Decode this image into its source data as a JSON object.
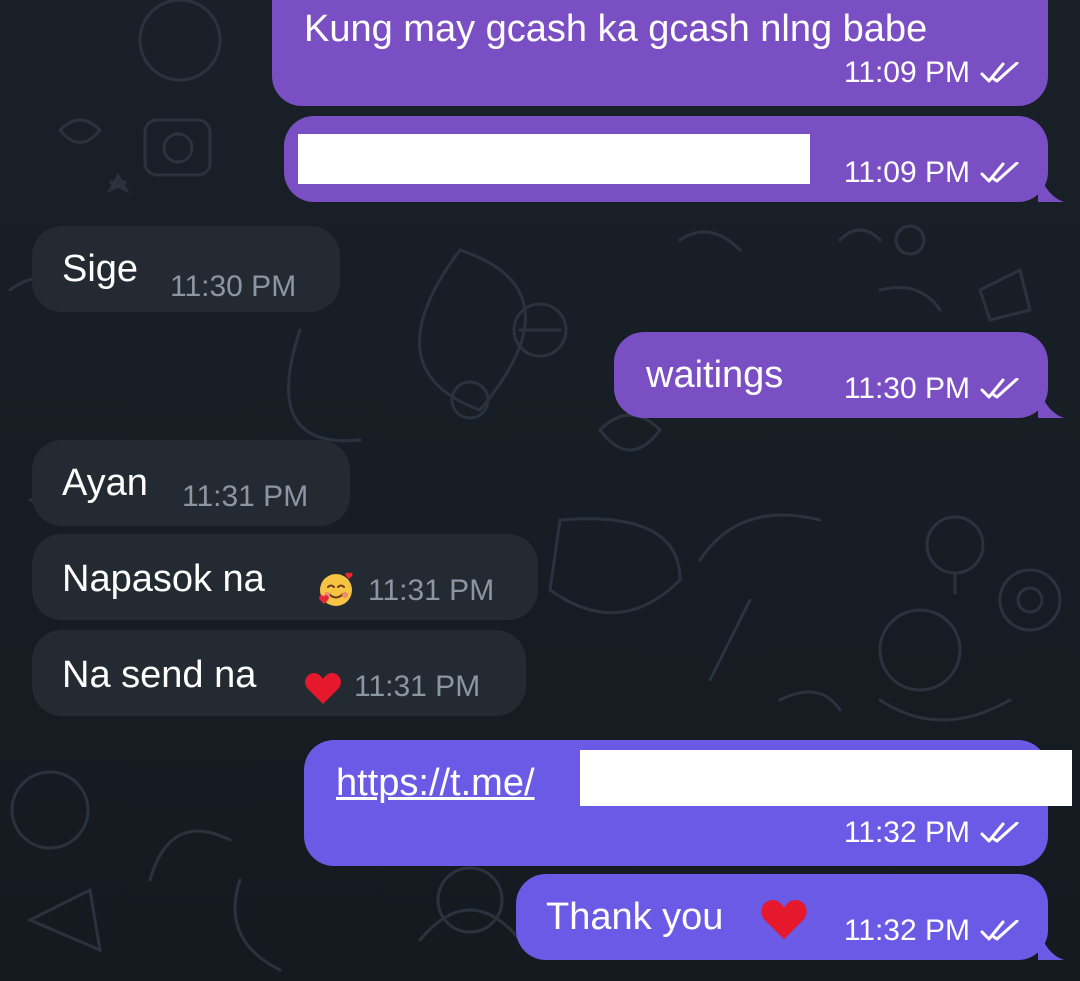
{
  "messages": [
    {
      "id": "m1",
      "direction": "outgoing",
      "text": "Kung may gcash ka gcash nlng babe",
      "time": "11:09 PM",
      "status": "read"
    },
    {
      "id": "m2",
      "direction": "outgoing",
      "text": "",
      "time": "11:09 PM",
      "status": "read",
      "redacted": true
    },
    {
      "id": "m3",
      "direction": "incoming",
      "text": "Sige",
      "time": "11:30 PM"
    },
    {
      "id": "m4",
      "direction": "outgoing",
      "text": "waitings",
      "time": "11:30 PM",
      "status": "read"
    },
    {
      "id": "m5",
      "direction": "incoming",
      "text": "Ayan",
      "time": "11:31 PM"
    },
    {
      "id": "m6",
      "direction": "incoming",
      "text": "Napasok na",
      "emoji": "smiling-face-with-hearts",
      "time": "11:31 PM"
    },
    {
      "id": "m7",
      "direction": "incoming",
      "text": "Na send na",
      "emoji": "red-heart",
      "time": "11:31 PM"
    },
    {
      "id": "m8",
      "direction": "outgoing",
      "text": "https://t.me/",
      "time": "11:32 PM",
      "status": "read",
      "link": true,
      "redacted": true
    },
    {
      "id": "m9",
      "direction": "outgoing",
      "text": "Thank you",
      "emoji": "red-heart",
      "time": "11:32 PM",
      "status": "read"
    }
  ],
  "colors": {
    "outgoing_bubble": "#7b4fc4",
    "outgoing_bubble_alt": "#6a5ae6",
    "incoming_bubble": "#232a32",
    "background": "#161c22",
    "incoming_time": "#8c96a2"
  }
}
